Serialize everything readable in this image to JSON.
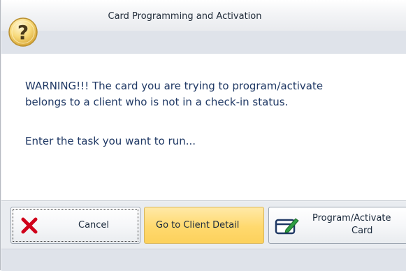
{
  "window": {
    "title": "Card Programming and Activation"
  },
  "message": {
    "line1": "WARNING!!! The card you are trying to program/activate",
    "line2": "belongs to a client who is not  in a check-in status.",
    "prompt": "Enter the task you want to run..."
  },
  "buttons": {
    "cancel": "Cancel",
    "client_detail": "Go to Client Detail",
    "program_line1": "Program/Activate",
    "program_line2": "Card"
  },
  "icons": {
    "help": "help-question-icon",
    "cancel": "red-x-icon",
    "program": "card-edit-icon"
  },
  "colors": {
    "accent_button": "#ffd96e",
    "text": "#1f3864",
    "cancel_icon": "#d0021b"
  }
}
